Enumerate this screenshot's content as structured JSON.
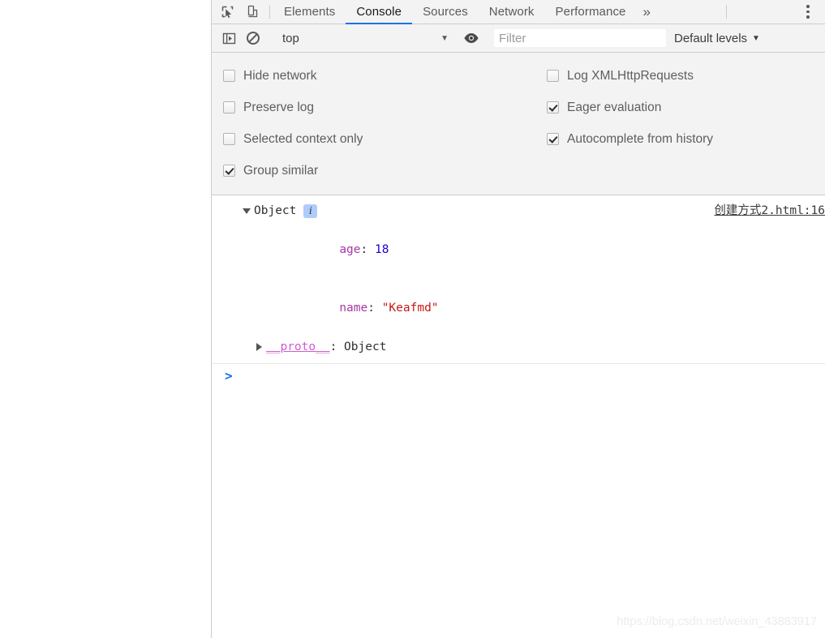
{
  "devtools": {
    "toolbar_icons": [
      {
        "name": "inspect-element-icon",
        "title": "Inspect element"
      },
      {
        "name": "device-toolbar-icon",
        "title": "Toggle device toolbar"
      }
    ],
    "tabs": [
      {
        "id": "elements",
        "label": "Elements",
        "selected": false
      },
      {
        "id": "console",
        "label": "Console",
        "selected": true
      },
      {
        "id": "sources",
        "label": "Sources",
        "selected": false
      },
      {
        "id": "network",
        "label": "Network",
        "selected": false
      },
      {
        "id": "performance",
        "label": "Performance",
        "selected": false
      }
    ],
    "more_tabs_label": "»",
    "accent_color": "#1a73e8"
  },
  "filterbar": {
    "sidebar_toggle": "console-sidebar-icon",
    "clear_console": "clear-console-icon",
    "context": {
      "value": "top",
      "caret": "▼"
    },
    "live_expression": "eye-icon",
    "filter": {
      "placeholder": "Filter",
      "value": ""
    },
    "levels": {
      "label": "Default levels",
      "caret": "▼"
    }
  },
  "settings": {
    "left": [
      {
        "id": "hide-network",
        "label": "Hide network",
        "checked": false
      },
      {
        "id": "preserve-log",
        "label": "Preserve log",
        "checked": false
      },
      {
        "id": "selected-context-only",
        "label": "Selected context only",
        "checked": false
      },
      {
        "id": "group-similar",
        "label": "Group similar",
        "checked": true
      }
    ],
    "right": [
      {
        "id": "log-xmlhttprequests",
        "label": "Log XMLHttpRequests",
        "checked": false
      },
      {
        "id": "eager-evaluation",
        "label": "Eager evaluation",
        "checked": true
      },
      {
        "id": "autocomplete-from-history",
        "label": "Autocomplete from history",
        "checked": true
      }
    ]
  },
  "console": {
    "entry": {
      "expander": "▼",
      "object_label": "Object",
      "info_badge": "i",
      "source_link": "创建方式2.html:16",
      "properties": [
        {
          "key": "age",
          "sep": ": ",
          "value": "18",
          "value_type": "number"
        },
        {
          "key": "name",
          "sep": ": ",
          "value": "\"Keafmd\"",
          "value_type": "string"
        }
      ],
      "proto": {
        "expander": "▶",
        "key": "__proto__",
        "sep": ": ",
        "value": "Object"
      }
    },
    "prompt_caret": ">"
  },
  "watermark": "https://blog.csdn.net/weixin_43883917"
}
